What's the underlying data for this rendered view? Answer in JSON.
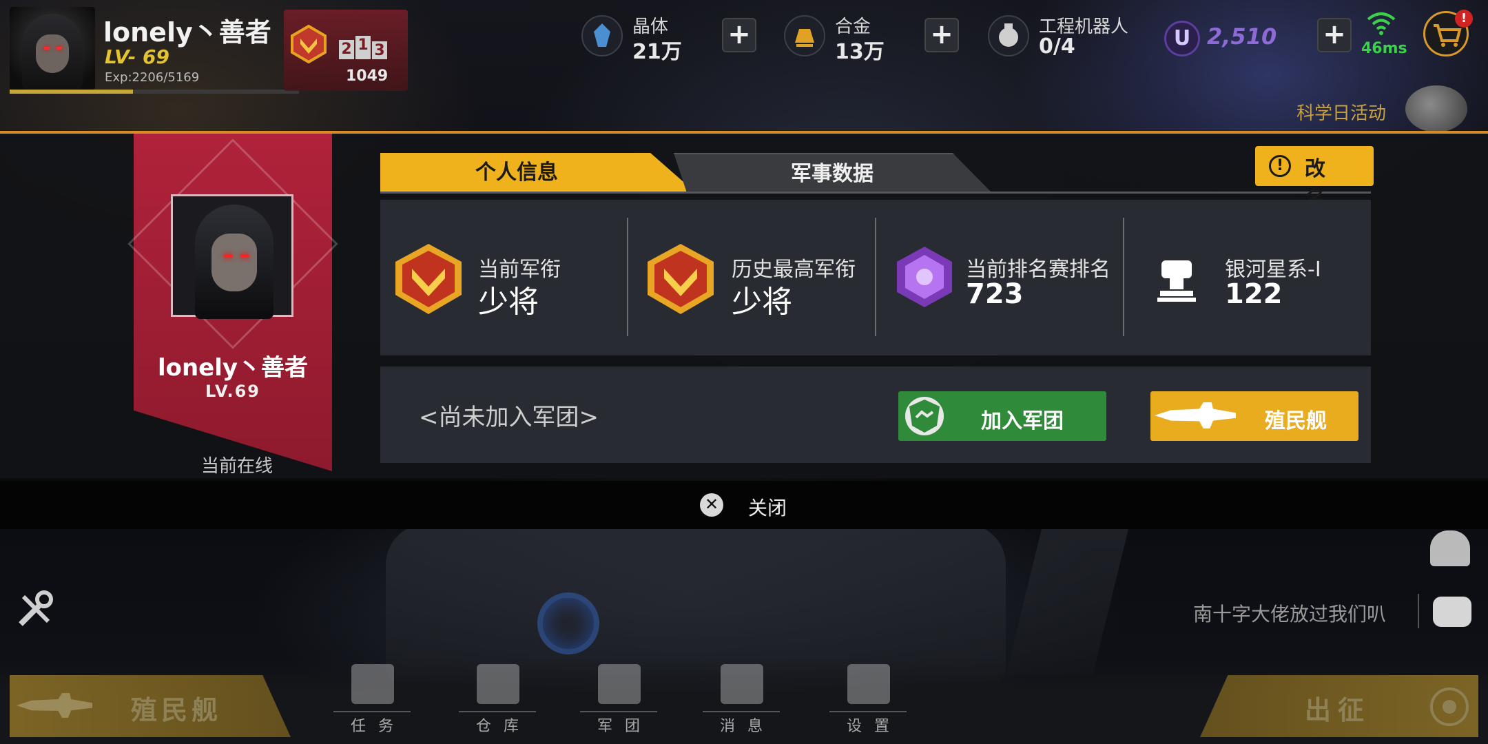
{
  "player": {
    "name": "lonely丶善者",
    "level_top": "LV- 69",
    "exp_text": "Exp:2206/5169",
    "exp_fraction": 0.427,
    "rank_count": "1049",
    "podium": [
      "2",
      "1",
      "3"
    ]
  },
  "resources": {
    "crystal": {
      "label": "晶体",
      "value": "21万",
      "icon": "crystal-icon"
    },
    "alloy": {
      "label": "合金",
      "value": "13万",
      "icon": "gold-bar-icon"
    },
    "robot": {
      "label": "工程机器人",
      "value": "0/4",
      "icon": "robot-icon"
    },
    "u_currency": {
      "symbol": "U",
      "value": "2,510"
    }
  },
  "network": {
    "ping": "46ms"
  },
  "shop": {
    "badge": "!"
  },
  "event": {
    "label": "科学日活动"
  },
  "profile": {
    "banner_name": "lonely丶善者",
    "banner_level": "LV.69",
    "online_status": "当前在线",
    "tabs": [
      {
        "label": "个人信息",
        "active": true
      },
      {
        "label": "军事数据",
        "active": false
      }
    ],
    "rename_label": "改 名",
    "stats": [
      {
        "label": "当前军衔",
        "value": "少将",
        "icon": "rank-medal-icon"
      },
      {
        "label": "历史最高军衔",
        "value": "少将",
        "icon": "rank-medal-icon"
      },
      {
        "label": "当前排名赛排名",
        "value": "723",
        "icon": "stellar-rank-icon"
      },
      {
        "label": "银河星系-I",
        "value": "122",
        "icon": "trophy-fist-icon"
      }
    ],
    "guild_status": "<尚未加入军团>",
    "join_guild_label": "加入军团",
    "colony_ship_label": "殖民舰",
    "close_label": "关闭"
  },
  "chat": {
    "message": "南十字大佬放过我们叭"
  },
  "bottom": {
    "colony_label": "殖民舰",
    "sortie_label": "出征",
    "nav": [
      {
        "label": "任务",
        "icon": "mission-icon"
      },
      {
        "label": "仓库",
        "icon": "warehouse-icon"
      },
      {
        "label": "军团",
        "icon": "legion-icon"
      },
      {
        "label": "消息",
        "icon": "message-icon"
      },
      {
        "label": "设置",
        "icon": "settings-icon"
      }
    ]
  },
  "colors": {
    "accent": "#efb21c",
    "banner": "#b0223a",
    "join": "#2f8a3a",
    "ping": "#3bd14b"
  }
}
